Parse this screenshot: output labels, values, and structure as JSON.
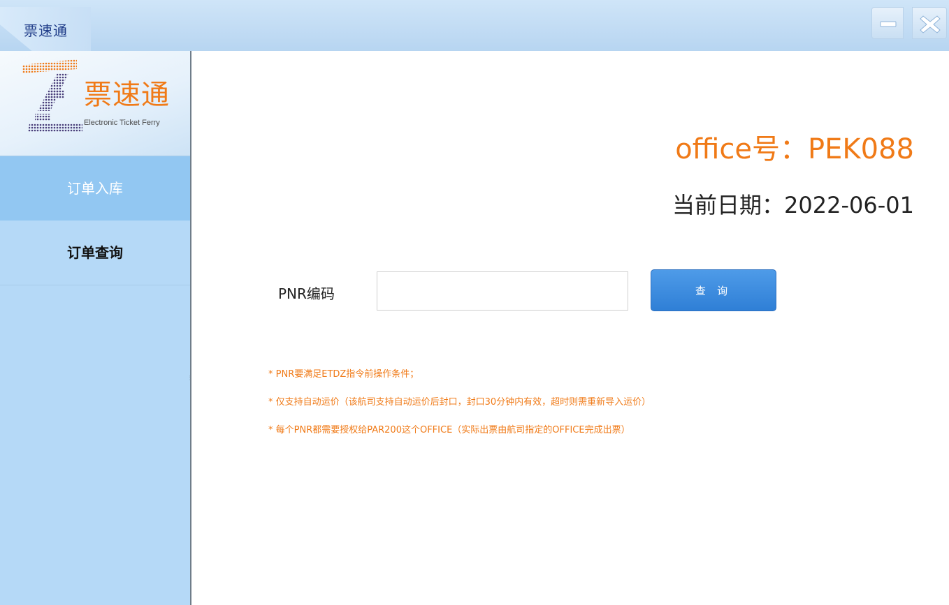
{
  "window": {
    "title": "票速通",
    "minimize_icon": "minimize-icon",
    "close_icon": "close-icon"
  },
  "logo": {
    "name": "票速通",
    "subtitle": "Electronic Ticket Ferry"
  },
  "sidebar": {
    "items": [
      {
        "label": "订单入库",
        "active": true
      },
      {
        "label": "订单查询",
        "active": false
      }
    ]
  },
  "main": {
    "office": "office号：PEK088",
    "date": "当前日期：2022-06-01",
    "pnr_label": "PNR编码",
    "pnr_value": "",
    "pnr_placeholder": "",
    "query_button": "查 询",
    "notes": [
      "* PNR要满足ETDZ指令前操作条件；",
      "* 仅支持自动运价（该航司支持自动运价后封口，封口30分钟内有效，超时则需重新导入运价）",
      "* 每个PNR都需要授权给PAR200这个OFFICE（实际出票由航司指定的OFFICE完成出票）"
    ]
  },
  "colors": {
    "accent": "#f07a17",
    "sidebar_bg": "#b5d9f7",
    "sidebar_active": "#92c7f2",
    "titlebar": "#c2dcf4",
    "button": "#3a88dc"
  }
}
